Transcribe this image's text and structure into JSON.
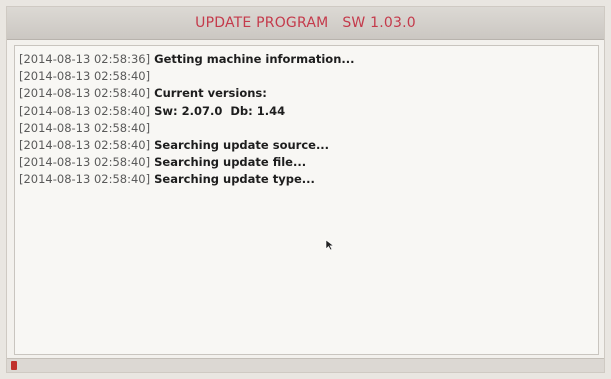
{
  "window": {
    "title": "UPDATE PROGRAM   SW 1.03.0"
  },
  "log": [
    {
      "time": "[2014-08-13 02:58:36]",
      "message": "Getting machine information..."
    },
    {
      "time": "[2014-08-13 02:58:40]",
      "message": ""
    },
    {
      "time": "[2014-08-13 02:58:40]",
      "message": "Current versions:"
    },
    {
      "time": "[2014-08-13 02:58:40]",
      "message": "Sw: 2.07.0  Db: 1.44"
    },
    {
      "time": "[2014-08-13 02:58:40]",
      "message": ""
    },
    {
      "time": "[2014-08-13 02:58:40]",
      "message": "Searching update source..."
    },
    {
      "time": "[2014-08-13 02:58:40]",
      "message": "Searching update file..."
    },
    {
      "time": "[2014-08-13 02:58:40]",
      "message": "Searching update type..."
    }
  ],
  "progress": {
    "fraction": 0.01,
    "color": "#c0302b"
  },
  "colors": {
    "title": "#c43a4b",
    "background": "#f3f1ed"
  },
  "icons": {
    "pointer": "mouse-pointer-icon"
  }
}
